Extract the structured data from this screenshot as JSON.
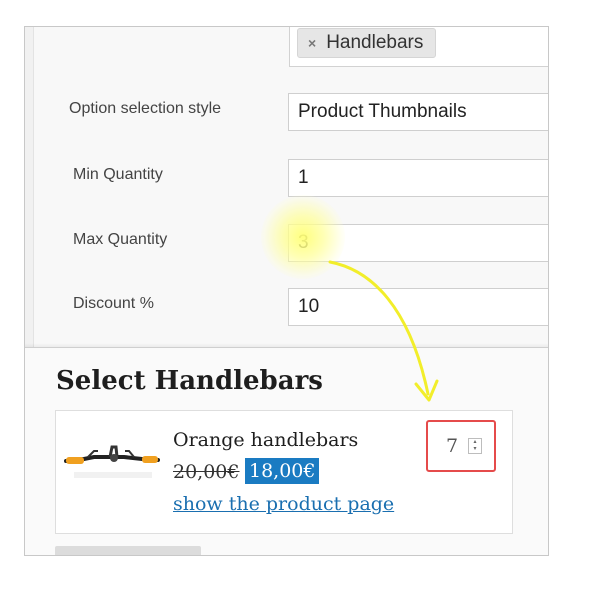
{
  "admin": {
    "tag": {
      "label": "Handlebars",
      "remove_symbol": "×"
    },
    "fields": [
      {
        "label": "Option selection style",
        "value": "Product Thumbnails"
      },
      {
        "label": "Min Quantity",
        "value": "1"
      },
      {
        "label": "Max Quantity",
        "value": "3"
      },
      {
        "label": "Discount %",
        "value": "10"
      }
    ]
  },
  "store": {
    "title": "Select Handlebars",
    "product": {
      "name": "Orange handlebars",
      "old_price": "20,00€",
      "new_price": "18,00€",
      "link": "show the product page",
      "quantity": "7",
      "spinner_up": "▴",
      "spinner_down": "▾"
    }
  },
  "colors": {
    "price_badge": "#1a7bc2",
    "link": "#1a6fb0",
    "qty_outline": "#e54b4b",
    "highlight": "#ffff78",
    "arrow": "#f2ee2a"
  },
  "icons": {
    "tag_remove": "close-icon",
    "annotation": "arrow-icon",
    "spinner": "spinner-arrows-icon"
  }
}
